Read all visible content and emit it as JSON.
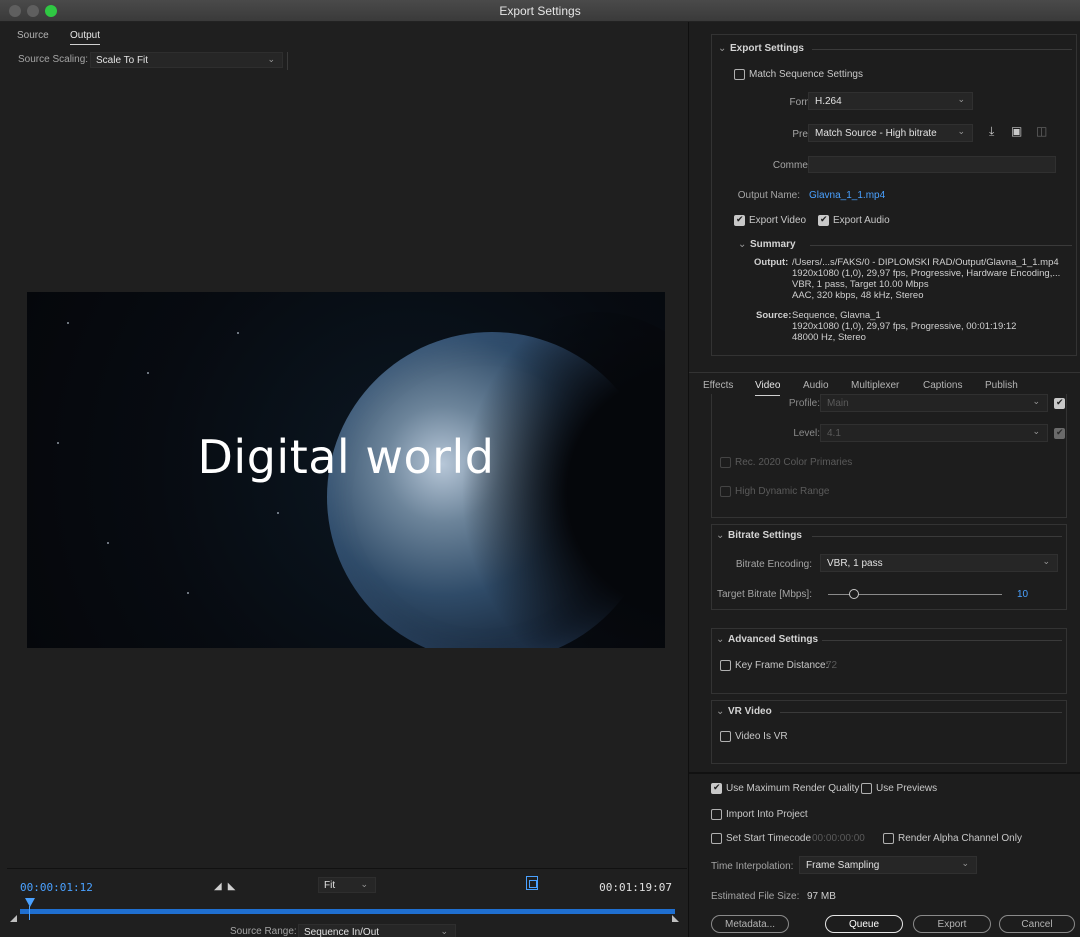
{
  "window": {
    "title": "Export Settings"
  },
  "left": {
    "tabs": [
      {
        "label": "Source"
      },
      {
        "label": "Output"
      }
    ],
    "source_scaling_label": "Source Scaling:",
    "source_scaling_value": "Scale To Fit",
    "preview_text": "Digital world",
    "timecode_current": "00:00:01:12",
    "timecode_end": "00:01:19:07",
    "zoom_value": "Fit",
    "source_range_label": "Source Range:",
    "source_range_value": "Sequence In/Out"
  },
  "export": {
    "section_title": "Export Settings",
    "match_sequence_label": "Match Sequence Settings",
    "match_sequence_checked": false,
    "format_label": "Format:",
    "format_value": "H.264",
    "preset_label": "Preset:",
    "preset_value": "Match Source - High bitrate",
    "comments_label": "Comments:",
    "comments_value": "",
    "output_name_label": "Output Name:",
    "output_name_value": "Glavna_1_1.mp4",
    "export_video_label": "Export Video",
    "export_video_checked": true,
    "export_audio_label": "Export Audio",
    "export_audio_checked": true,
    "summary_title": "Summary",
    "output_label": "Output:",
    "output_lines": [
      "/Users/...s/FAKS/0 - DIPLOMSKI RAD/Output/Glavna_1_1.mp4",
      "1920x1080 (1,0), 29,97 fps, Progressive, Hardware Encoding,...",
      "VBR, 1 pass, Target 10.00 Mbps",
      "AAC, 320 kbps, 48 kHz, Stereo"
    ],
    "source_label": "Source:",
    "source_lines": [
      "Sequence, Glavna_1",
      "1920x1080 (1,0), 29,97 fps, Progressive, 00:01:19:12",
      "48000 Hz, Stereo"
    ]
  },
  "tabs": [
    {
      "label": "Effects"
    },
    {
      "label": "Video"
    },
    {
      "label": "Audio"
    },
    {
      "label": "Multiplexer"
    },
    {
      "label": "Captions"
    },
    {
      "label": "Publish"
    }
  ],
  "video": {
    "profile_label": "Profile:",
    "profile_value": "Main",
    "level_label": "Level:",
    "level_value": "4.1",
    "rec2020_label": "Rec. 2020 Color Primaries",
    "hdr_label": "High Dynamic Range"
  },
  "bitrate": {
    "section_title": "Bitrate Settings",
    "encoding_label": "Bitrate Encoding:",
    "encoding_value": "VBR, 1 pass",
    "target_label": "Target Bitrate [Mbps]:",
    "target_value": "10",
    "target_fraction": 0.15
  },
  "advanced": {
    "section_title": "Advanced Settings",
    "keyframe_label": "Key Frame Distance:",
    "keyframe_value": "72"
  },
  "vr": {
    "section_title": "VR Video",
    "video_is_vr_label": "Video Is VR"
  },
  "footer": {
    "max_render_label": "Use Maximum Render Quality",
    "max_render_checked": true,
    "use_previews_label": "Use Previews",
    "import_label": "Import Into Project",
    "start_tc_label": "Set Start Timecode",
    "start_tc_value": "00:00:00:00",
    "alpha_label": "Render Alpha Channel Only",
    "interp_label": "Time Interpolation:",
    "interp_value": "Frame Sampling",
    "file_size_label": "Estimated File Size:",
    "file_size_value": "97 MB",
    "metadata_btn": "Metadata...",
    "queue_btn": "Queue",
    "export_btn": "Export",
    "cancel_btn": "Cancel"
  },
  "colors": {
    "accent": "#4aa1ff",
    "background": "#1d1d1d",
    "traffic_green": "#2fc843"
  },
  "icons": [
    "chevron-down-icon",
    "save-preset-icon",
    "import-preset-icon",
    "delete-preset-icon",
    "crop-icon",
    "mark-in-icon",
    "mark-out-icon"
  ]
}
